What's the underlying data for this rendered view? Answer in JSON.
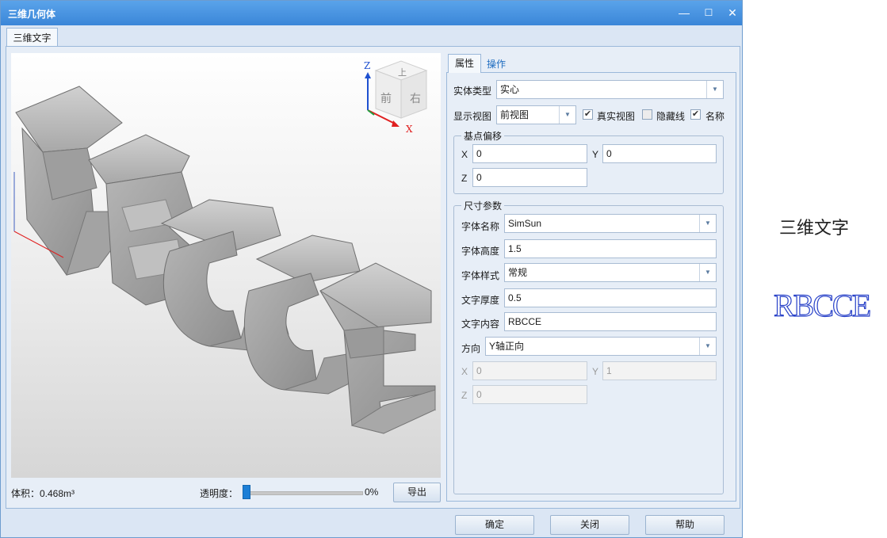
{
  "window": {
    "title": "三维几何体",
    "minimize": "—",
    "maximize": "☐",
    "close": "✕"
  },
  "tabs": {
    "main": "三维文字"
  },
  "viewport": {
    "cube": {
      "top": "上",
      "front": "前",
      "right": "右"
    },
    "axes": {
      "z": "Z",
      "x": "X"
    },
    "text3d": "RBCCE"
  },
  "bottom": {
    "volume": "体积：0.468m³",
    "transparency_label": "透明度：",
    "transparency_pct": "0%",
    "transparency_value": 0,
    "export": "导出"
  },
  "panel": {
    "tabs": [
      "属性",
      "操作"
    ],
    "entity_type": {
      "label": "实体类型",
      "value": "实心"
    },
    "display_view": {
      "label": "显示视图",
      "value": "前视图"
    },
    "checks": [
      {
        "label": "真实视图",
        "checked": true
      },
      {
        "label": "隐藏线",
        "checked": false
      },
      {
        "label": "名称",
        "checked": true
      }
    ],
    "base_offset": {
      "title": "基点偏移",
      "x_label": "X",
      "x": "0",
      "y_label": "Y",
      "y": "0",
      "z_label": "Z",
      "z": "0"
    },
    "size": {
      "title": "尺寸参数",
      "font_name": {
        "label": "字体名称",
        "value": "SimSun"
      },
      "font_height": {
        "label": "字体高度",
        "value": "1.5"
      },
      "font_style": {
        "label": "字体样式",
        "value": "常规"
      },
      "thickness": {
        "label": "文字厚度",
        "value": "0.5"
      },
      "content": {
        "label": "文字内容",
        "value": "RBCCE"
      },
      "direction": {
        "label": "方向",
        "value": "Y轴正向"
      },
      "dir_x_label": "X",
      "dir_x": "0",
      "dir_y_label": "Y",
      "dir_y": "1",
      "dir_z_label": "Z",
      "dir_z": "0"
    }
  },
  "footer": {
    "ok": "确定",
    "close": "关闭",
    "help": "帮助"
  },
  "preview": {
    "title": "三维文字",
    "logo": "RBCCE"
  },
  "colors": {
    "titlebar": "#3a86d8",
    "accent": "#1d7fd6",
    "logo_stroke": "#2740c8"
  }
}
